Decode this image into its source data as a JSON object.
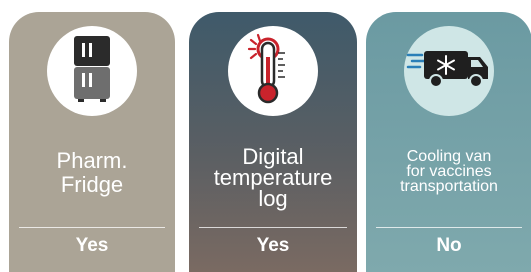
{
  "cards": [
    {
      "icon": "fridge-icon",
      "title_lines": [
        "Pharm.",
        "Fridge"
      ],
      "answer": "Yes"
    },
    {
      "icon": "thermometer-icon",
      "title_lines": [
        "Digital",
        "temperature",
        "log"
      ],
      "answer": "Yes"
    },
    {
      "icon": "refrigerated-van-icon",
      "title_lines": [
        "Cooling van",
        "for vaccines",
        "transportation"
      ],
      "answer": "No"
    }
  ],
  "colors": {
    "card1": "#aba496",
    "card2_top": "#3f5a6a",
    "card2_bottom": "#7a6a62",
    "card3": "#7fa9ad",
    "thermo_red": "#c9232c",
    "icon_dark": "#2a2a2a"
  }
}
